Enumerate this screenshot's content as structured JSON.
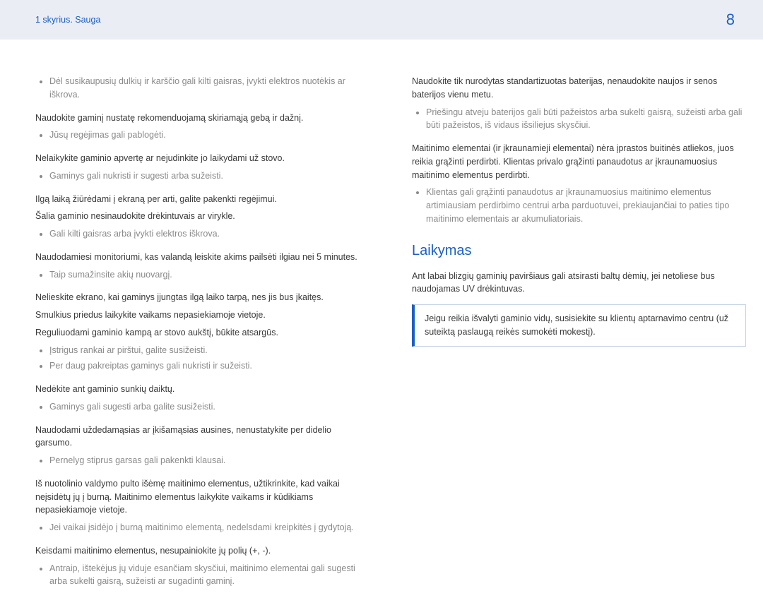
{
  "header": {
    "breadcrumb": "1 skyrius. Sauga",
    "page": "8"
  },
  "left": {
    "blocks": [
      {
        "bullet": "Dėl susikaupusių dulkių ir karščio gali kilti gaisras, įvykti elektros nuotėkis ar iškrova."
      },
      {
        "text": "Naudokite gaminį nustatę rekomenduojamą skiriamąją gebą ir dažnį."
      },
      {
        "bullet": "Jūsų regėjimas gali pablogėti."
      },
      {
        "text": "Nelaikykite gaminio apvertę ar nejudinkite jo laikydami už stovo."
      },
      {
        "bullet": "Gaminys gali nukristi ir sugesti arba sužeisti."
      },
      {
        "text": "Ilgą laiką žiūrėdami į ekraną per arti, galite pakenkti regėjimui."
      },
      {
        "text": "Šalia gaminio nesinaudokite drėkintuvais ar virykle."
      },
      {
        "bullet": "Gali kilti gaisras arba įvykti elektros iškrova."
      },
      {
        "text": "Naudodamiesi monitoriumi, kas valandą leiskite akims pailsėti ilgiau nei 5 minutes."
      },
      {
        "bullet": "Taip sumažinsite akių nuovargį."
      },
      {
        "text": "Nelieskite ekrano, kai gaminys įjungtas ilgą laiko tarpą, nes jis bus įkaitęs."
      },
      {
        "text": "Smulkius priedus laikykite vaikams nepasiekiamoje vietoje."
      },
      {
        "text": "Reguliuodami gaminio kampą ar stovo aukštį, būkite atsargūs."
      },
      {
        "bullet": "Įstrigus rankai ar pirštui, galite susižeisti."
      },
      {
        "bullet": "Per daug pakreiptas gaminys gali nukristi ir sužeisti."
      },
      {
        "text": "Nedėkite ant gaminio sunkių daiktų."
      },
      {
        "bullet": "Gaminys gali sugesti arba galite susižeisti."
      },
      {
        "text": "Naudodami uždedamąsias ar įkišamąsias ausines, nenustatykite per didelio garsumo."
      },
      {
        "bullet": "Pernelyg stiprus garsas gali pakenkti klausai."
      },
      {
        "text": "Iš nuotolinio valdymo pulto išėmę maitinimo elementus, užtikrinkite, kad vaikai neįsidėtų jų į burną. Maitinimo elementus laikykite vaikams ir kūdikiams nepasiekiamoje vietoje."
      },
      {
        "bullet": "Jei vaikai įsidėjo į burną maitinimo elementą, nedelsdami kreipkitės į gydytoją."
      },
      {
        "text": "Keisdami maitinimo elementus, nesupainiokite jų polių (+, -)."
      },
      {
        "bullet": "Antraip, ištekėjus jų viduje esančiam skysčiui, maitinimo elementai gali sugesti arba sukelti gaisrą, sužeisti ar sugadinti gaminį."
      }
    ]
  },
  "right": {
    "blocks": [
      {
        "text": "Naudokite tik nurodytas standartizuotas baterijas, nenaudokite naujos ir senos baterijos vienu metu."
      },
      {
        "bullet": "Priešingu atveju baterijos gali būti pažeistos arba sukelti gaisrą, sužeisti arba gali būti pažeistos, iš vidaus išsiliejus skysčiui."
      },
      {
        "text": "Maitinimo elementai (ir įkraunamieji elementai) nėra įprastos buitinės atliekos, juos reikia grąžinti perdirbti. Klientas privalo grąžinti panaudotus ar įkraunamuosius maitinimo elementus perdirbti."
      },
      {
        "bullet": "Klientas gali grąžinti panaudotus ar įkraunamuosius maitinimo elementus artimiausiam perdirbimo centrui arba parduotuvei, prekiaujančiai to paties tipo maitinimo elementais ar akumuliatoriais."
      }
    ],
    "section_title": "Laikymas",
    "section_text": "Ant labai blizgių gaminių paviršiaus gali atsirasti baltų dėmių, jei netoliese bus naudojamas UV drėkintuvas.",
    "note": "Jeigu reikia išvalyti gaminio vidų, susisiekite su klientų aptarnavimo centru (už suteiktą paslaugą reikės sumokėti mokestį)."
  }
}
